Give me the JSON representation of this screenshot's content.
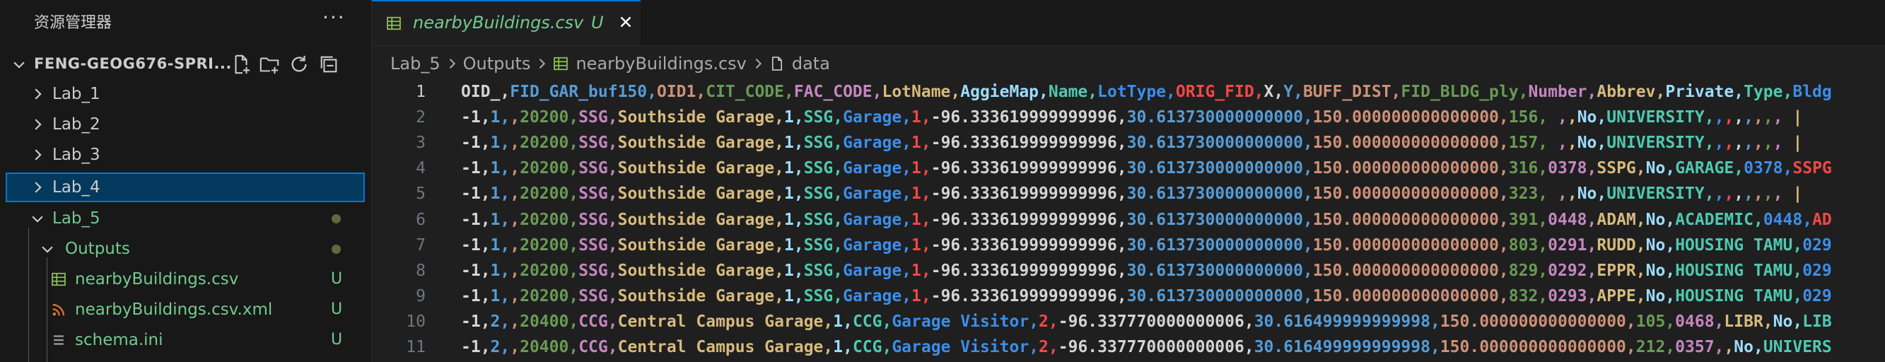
{
  "sidebar": {
    "title": "资源管理器",
    "more_label": "···",
    "section_title": "FENG-GEOG676-SPRI...",
    "items": [
      {
        "label": "Lab_1",
        "depth": 1,
        "kind": "folder",
        "expanded": false
      },
      {
        "label": "Lab_2",
        "depth": 1,
        "kind": "folder",
        "expanded": false
      },
      {
        "label": "Lab_3",
        "depth": 1,
        "kind": "folder",
        "expanded": false
      },
      {
        "label": "Lab_4",
        "depth": 1,
        "kind": "folder",
        "expanded": false,
        "selected": true
      },
      {
        "label": "Lab_5",
        "depth": 1,
        "kind": "folder",
        "expanded": true,
        "color": "#73c991",
        "dot": true
      },
      {
        "label": "Outputs",
        "depth": 2,
        "kind": "folder",
        "expanded": true,
        "color": "#73c991",
        "dot": true
      },
      {
        "label": "nearbyBuildings.csv",
        "depth": 3,
        "kind": "csv-file",
        "color": "#73c991",
        "status": "U"
      },
      {
        "label": "nearbyBuildings.csv.xml",
        "depth": 3,
        "kind": "rss-file",
        "color": "#73c991",
        "status": "U"
      },
      {
        "label": "schema.ini",
        "depth": 3,
        "kind": "lines-file",
        "color": "#73c991",
        "status": "U"
      }
    ]
  },
  "tab": {
    "label": "nearbyBuildings.csv",
    "status": "U"
  },
  "breadcrumb": {
    "parts": [
      "Lab_5",
      "Outputs",
      "nearbyBuildings.csv",
      "data"
    ]
  },
  "column_colors": [
    "#d4d4d4",
    "#569cd6",
    "#ce9178",
    "#6a9955",
    "#c586c0",
    "#d7ba7d",
    "#9cdcfe",
    "#4ec9b0",
    "#3b8eea",
    "#f44747"
  ],
  "editor": {
    "lines": [
      {
        "num": "1",
        "text": "OID_,FID_GAR_buf150,OID1,CIT_CODE,FAC_CODE,LotName,AggieMap,Name,LotType,ORIG_FID,X,Y,BUFF_DIST,FID_BLDG_ply,Number,Abbrev,Private,Type,Bldg"
      },
      {
        "num": "2",
        "text": "-1,1,,20200,SSG,Southside Garage,1,SSG,Garage,1,-96.333619999999996,30.613730000000000,150.000000000000000,156, ,,No,UNIVERSITY,,,,,,,, |"
      },
      {
        "num": "3",
        "text": "-1,1,,20200,SSG,Southside Garage,1,SSG,Garage,1,-96.333619999999996,30.613730000000000,150.000000000000000,157, ,,No,UNIVERSITY,,,,,,,, |"
      },
      {
        "num": "4",
        "text": "-1,1,,20200,SSG,Southside Garage,1,SSG,Garage,1,-96.333619999999996,30.613730000000000,150.000000000000000,316,0378,SSPG,No,GARAGE,0378,SSPG"
      },
      {
        "num": "5",
        "text": "-1,1,,20200,SSG,Southside Garage,1,SSG,Garage,1,-96.333619999999996,30.613730000000000,150.000000000000000,323, ,,No,UNIVERSITY,,,,,,,, |"
      },
      {
        "num": "6",
        "text": "-1,1,,20200,SSG,Southside Garage,1,SSG,Garage,1,-96.333619999999996,30.613730000000000,150.000000000000000,391,0448,ADAM,No,ACADEMIC,0448,AD"
      },
      {
        "num": "7",
        "text": "-1,1,,20200,SSG,Southside Garage,1,SSG,Garage,1,-96.333619999999996,30.613730000000000,150.000000000000000,803,0291,RUDD,No,HOUSING TAMU,029"
      },
      {
        "num": "8",
        "text": "-1,1,,20200,SSG,Southside Garage,1,SSG,Garage,1,-96.333619999999996,30.613730000000000,150.000000000000000,829,0292,EPPR,No,HOUSING TAMU,029"
      },
      {
        "num": "9",
        "text": "-1,1,,20200,SSG,Southside Garage,1,SSG,Garage,1,-96.333619999999996,30.613730000000000,150.000000000000000,832,0293,APPE,No,HOUSING TAMU,029"
      },
      {
        "num": "10",
        "text": "-1,2,,20400,CCG,Central Campus Garage,1,CCG,Garage Visitor,2,-96.337770000000006,30.616499999999998,150.000000000000000,105,0468,LIBR,No,LIB"
      },
      {
        "num": "11",
        "text": "-1,2,,20400,CCG,Central Campus Garage,1,CCG,Garage Visitor,2,-96.337770000000006,30.616499999999998,150.000000000000000,212,0357,,No,UNIVERS"
      }
    ]
  }
}
